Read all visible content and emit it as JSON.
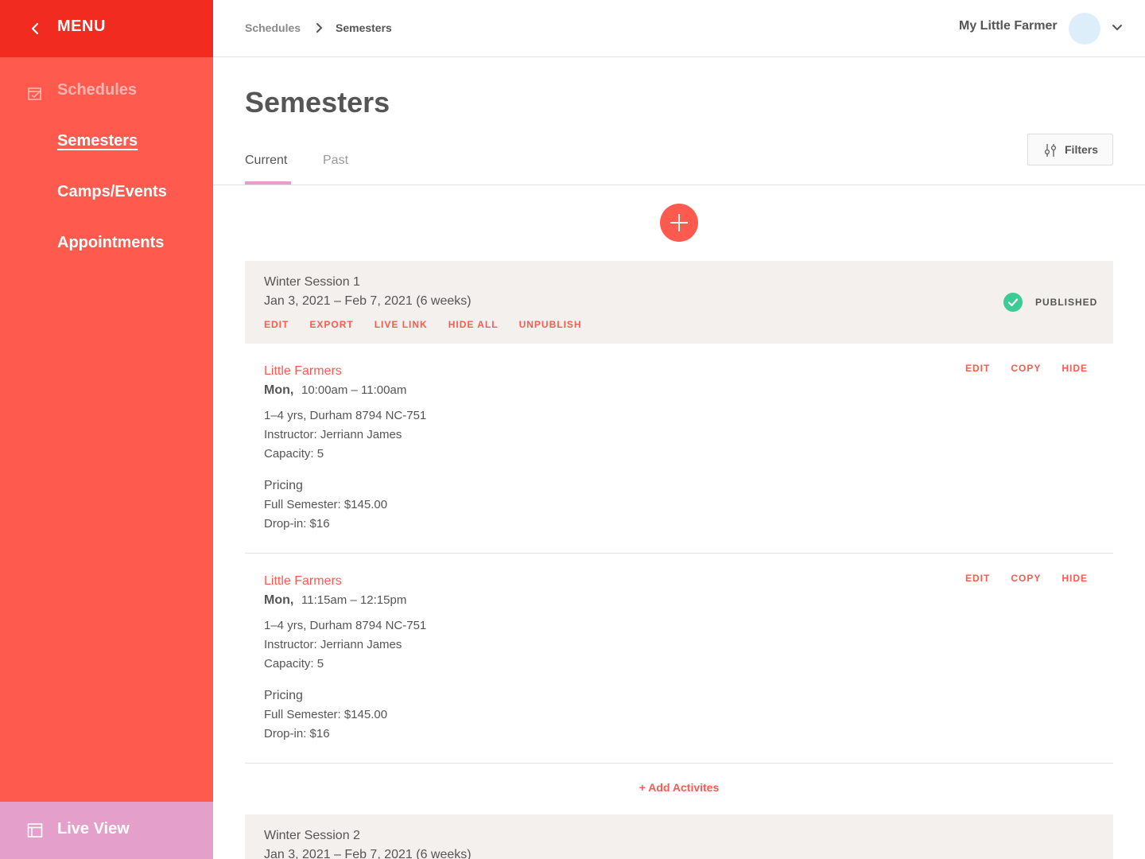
{
  "sidebar": {
    "menu_label": "MENU",
    "items": [
      {
        "label": "Schedules"
      },
      {
        "label": "Semesters"
      },
      {
        "label": "Camps/Events"
      },
      {
        "label": "Appointments"
      }
    ],
    "live_view_label": "Live View",
    "bg_color": "#ff5a4e",
    "menu_bar_color": "#f12b1f",
    "live_view_color": "#e4a0ca"
  },
  "topbar": {
    "breadcrumb": [
      "Schedules",
      "Semesters"
    ],
    "account_name": "My Little Farmer"
  },
  "page": {
    "title": "Semesters",
    "tabs": [
      {
        "label": "Current"
      },
      {
        "label": "Past"
      }
    ],
    "filters_label": "Filters",
    "add_activities_label": "+ Add Activites"
  },
  "sessions": [
    {
      "title": "Winter Session 1",
      "dates": "Jan 3, 2021 – Feb 7, 2021 (6 weeks)",
      "actions": [
        "EDIT",
        "EXPORT",
        "LIVE LINK",
        "HIDE ALL",
        "UNPUBLISH"
      ],
      "status": "PUBLISHED",
      "activities": [
        {
          "name": "Little Farmers",
          "day": "Mon,",
          "time": "10:00am – 11:00am",
          "details": [
            "1–4 yrs, Durham 8794 NC-751",
            "Instructor: Jerriann James",
            "Capacity: 5"
          ],
          "pricing_label": "Pricing",
          "pricing": [
            "Full Semester: $145.00",
            "Drop-in: $16"
          ],
          "actions": [
            "EDIT",
            "COPY",
            "HIDE"
          ]
        },
        {
          "name": "Little Farmers",
          "day": "Mon,",
          "time": "11:15am – 12:15pm",
          "details": [
            "1–4 yrs, Durham 8794 NC-751",
            "Instructor: Jerriann James",
            "Capacity: 5"
          ],
          "pricing_label": "Pricing",
          "pricing": [
            "Full Semester: $145.00",
            "Drop-in: $16"
          ],
          "actions": [
            "EDIT",
            "COPY",
            "HIDE"
          ]
        }
      ]
    },
    {
      "title": "Winter Session 2",
      "dates": "Jan 3, 2021 – Feb 7, 2021 (6 weeks)"
    }
  ],
  "colors": {
    "accent": "#ff5a4e",
    "published_check": "#3ccb94",
    "tab_indicator": "#e4a0ca",
    "session_bg": "#f3f0ed"
  }
}
